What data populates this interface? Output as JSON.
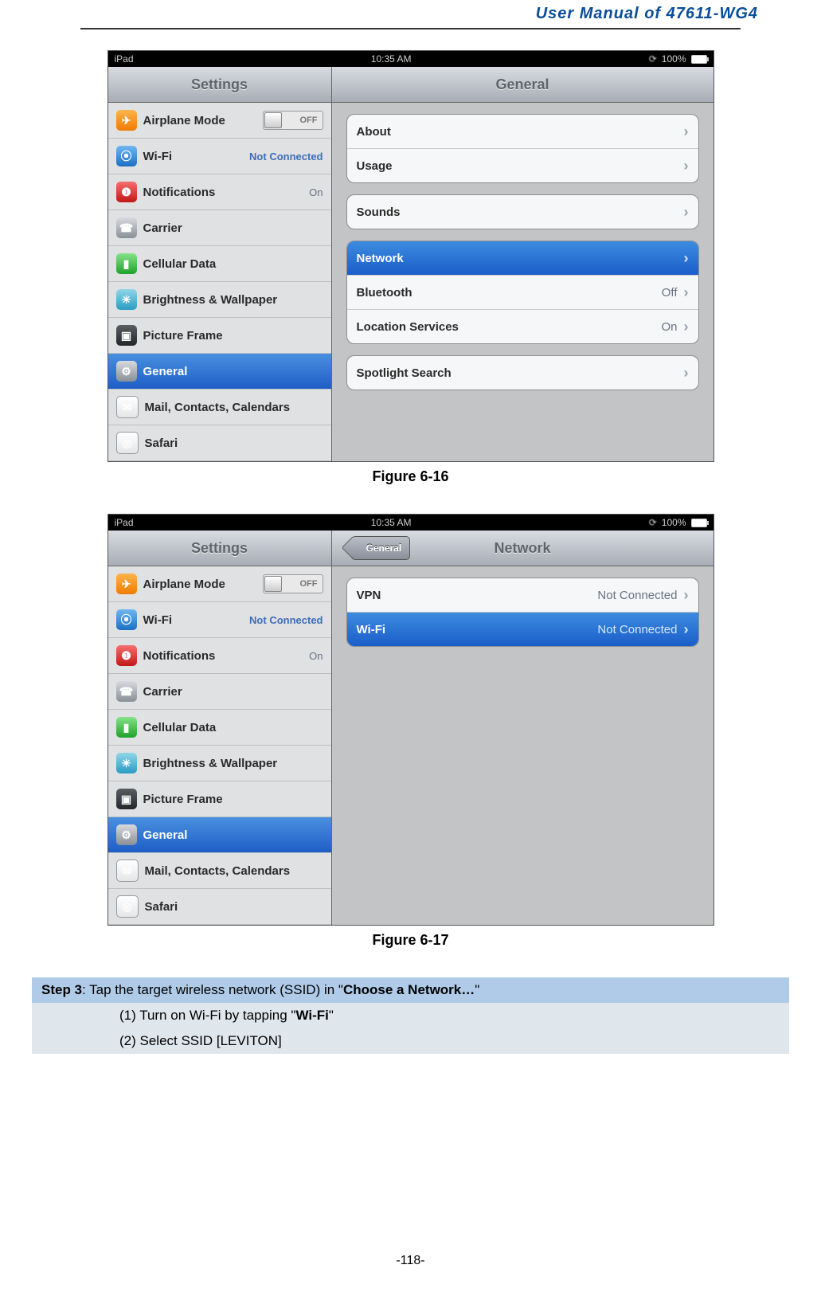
{
  "doc": {
    "header_title": "User Manual of 47611-WG4",
    "page_number": "-118-"
  },
  "captions": {
    "fig1": "Figure 6-16",
    "fig2": "Figure 6-17"
  },
  "status": {
    "device": "iPad",
    "time": "10:35 AM",
    "battery": "100%"
  },
  "titles": {
    "settings": "Settings",
    "general": "General",
    "network": "Network",
    "back_general": "General"
  },
  "sidebar": {
    "items": [
      {
        "label": "Airplane Mode",
        "right": "OFF",
        "icon": "airplane"
      },
      {
        "label": "Wi-Fi",
        "right": "Not Connected",
        "icon": "wifi",
        "right_blue": true
      },
      {
        "label": "Notifications",
        "right": "On",
        "icon": "notif"
      },
      {
        "label": "Carrier",
        "right": "",
        "icon": "carrier"
      },
      {
        "label": "Cellular Data",
        "right": "",
        "icon": "cell"
      },
      {
        "label": "Brightness & Wallpaper",
        "right": "",
        "icon": "bright"
      },
      {
        "label": "Picture Frame",
        "right": "",
        "icon": "frame"
      },
      {
        "label": "General",
        "right": "",
        "icon": "general",
        "selected": true
      },
      {
        "label": "Mail, Contacts, Calendars",
        "right": "",
        "icon": "mail"
      },
      {
        "label": "Safari",
        "right": "",
        "icon": "safari"
      }
    ]
  },
  "fig1_content": {
    "group1": [
      {
        "label": "About"
      },
      {
        "label": "Usage"
      }
    ],
    "group2": [
      {
        "label": "Sounds"
      }
    ],
    "group3": [
      {
        "label": "Network",
        "selected": true
      },
      {
        "label": "Bluetooth",
        "right": "Off"
      },
      {
        "label": "Location Services",
        "right": "On"
      }
    ],
    "group4": [
      {
        "label": "Spotlight Search"
      }
    ]
  },
  "fig2_content": {
    "group1": [
      {
        "label": "VPN",
        "right": "Not Connected"
      },
      {
        "label": "Wi-Fi",
        "right": "Not Connected",
        "selected": true
      }
    ]
  },
  "step": {
    "head_prefix": "Step 3",
    "head_rest": ": Tap the target wireless network (SSID) in \"",
    "head_bold": "Choose a Network…",
    "head_end": "\"",
    "sub1_prefix": "(1)  Turn on Wi-Fi by tapping \"",
    "sub1_bold": "Wi-Fi",
    "sub1_end": "\"",
    "sub2": "(2)  Select SSID [LEVITON]"
  }
}
